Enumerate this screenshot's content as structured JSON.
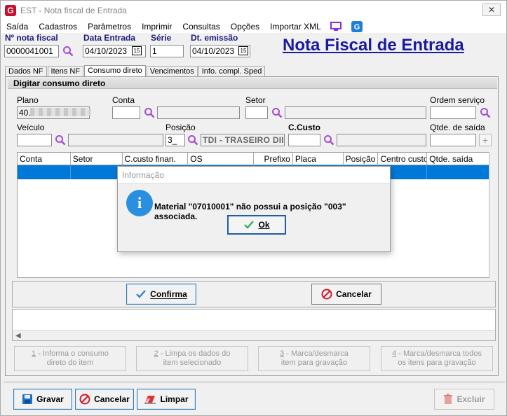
{
  "window": {
    "title": "EST - Nota fiscal de Entrada",
    "close_glyph": "✕"
  },
  "menu": {
    "items": [
      "Saída",
      "Cadastros",
      "Parâmetros",
      "Imprimir",
      "Consultas",
      "Opções",
      "Importar XML"
    ],
    "icons": [
      "monitor-icon",
      "g-app-icon"
    ]
  },
  "header": {
    "nota_label": "Nº nota fiscal",
    "nota_value": "0000041001",
    "data_entrada_label": "Data Entrada",
    "data_entrada_value": "04/10/2023",
    "serie_label": "Série",
    "serie_value": "1",
    "dt_emissao_label": "Dt. emissão",
    "dt_emissao_value": "04/10/2023",
    "calendar_glyph": "15",
    "page_title": "Nota Fiscal de Entrada"
  },
  "tabs": [
    "Dados NF",
    "Itens NF",
    "Consumo direto",
    "Vencimentos",
    "Info. compl. Sped"
  ],
  "active_tab": "Consumo direto",
  "panel": {
    "header": "Digitar consumo direto",
    "plano_label": "Plano",
    "plano_value": "40.",
    "conta_label": "Conta",
    "setor_label": "Setor",
    "ordem_label": "Ordem serviço",
    "veiculo_label": "Veículo",
    "posicao_label": "Posição",
    "posicao_value": "3_",
    "posicao_desc": "TDI - TRASEIRO DII",
    "ccusto_label": "C.Custo",
    "qtde_label": "Qtde. de saída",
    "plus_glyph": "+"
  },
  "grid": {
    "columns": [
      "Conta",
      "Setor",
      "C.custo finan.",
      "OS",
      "Prefixo",
      "Placa",
      "Posição",
      "Centro custo",
      "Qtde. saída"
    ]
  },
  "actions": {
    "confirma": "Confirma",
    "cancelar": "Cancelar"
  },
  "steps": [
    {
      "num": "1",
      "text1": " - Informa o consumo",
      "text2": "direto do item"
    },
    {
      "num": "2",
      "text1": " - Limpa os dados do",
      "text2": "item selecionado"
    },
    {
      "num": "3",
      "text1": " - Marca/desmarca",
      "text2": "item para gravação"
    },
    {
      "num": "4",
      "text1": " - Marca/desmarca todos",
      "text2": "os itens para gravação"
    }
  ],
  "footer": {
    "gravar": "Gravar",
    "cancelar": "Cancelar",
    "limpar": "Limpar",
    "excluir": "Excluir"
  },
  "dialog": {
    "title": "Informação",
    "icon_glyph": "i",
    "message": "Material \"07010001\" não possui a posição \"003\" associada.",
    "ok_label": "Ok"
  },
  "colors": {
    "accent": "#0078d7",
    "title_blue": "#1a1aa0",
    "search_purple": "#a64dd6",
    "brand_red": "#c8102e"
  }
}
